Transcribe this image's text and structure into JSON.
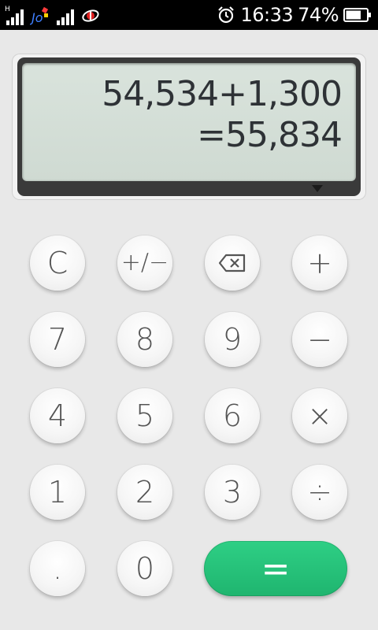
{
  "status_bar": {
    "network_label_1": "H",
    "network_label_2": "",
    "time": "16:33",
    "battery": "74%",
    "icons": [
      "signal-icon",
      "app-notification-icon",
      "signal-icon",
      "network-notification-icon",
      "alarm-icon",
      "battery-icon"
    ],
    "battery_level": 0.74
  },
  "display": {
    "expression": "54,534+1,300",
    "result": "=55,834"
  },
  "keys": {
    "clear": "C",
    "sign": "+∕−",
    "backspace_icon": "backspace-icon",
    "plus": "+",
    "seven": "7",
    "eight": "8",
    "nine": "9",
    "minus": "−",
    "four": "4",
    "five": "5",
    "six": "6",
    "multiply": "×",
    "one": "1",
    "two": "2",
    "three": "3",
    "divide": "÷",
    "dot": ".",
    "zero": "0",
    "equals": "="
  },
  "colors": {
    "equals_key": "#23c27a",
    "display_bg": "#d5dfd8",
    "display_text": "#2e3236",
    "key_text": "#555555",
    "background": "#e8e8e8"
  }
}
